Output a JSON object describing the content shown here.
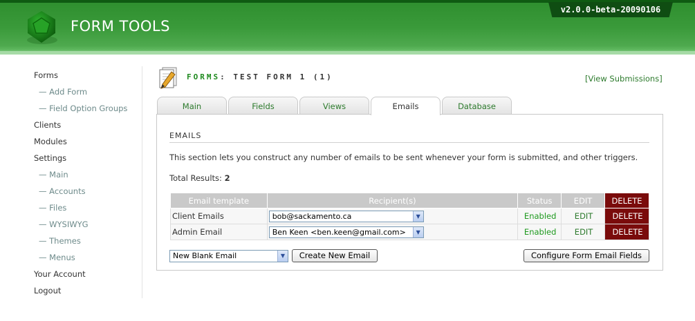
{
  "app": {
    "title": "FORM TOOLS",
    "version": "v2.0.0-beta-20090106"
  },
  "colors": {
    "brand_green": "#3a9a3a",
    "dark_green": "#0f4d12",
    "delete_red": "#7a0b0b",
    "link_green": "#2c7a2c"
  },
  "sidebar": {
    "items": [
      {
        "label": "Forms",
        "level": 0
      },
      {
        "label": "— Add Form",
        "level": 1
      },
      {
        "label": "— Field Option Groups",
        "level": 1
      },
      {
        "label": "Clients",
        "level": 0
      },
      {
        "label": "Modules",
        "level": 0
      },
      {
        "label": "Settings",
        "level": 0
      },
      {
        "label": "— Main",
        "level": 1
      },
      {
        "label": "— Accounts",
        "level": 1
      },
      {
        "label": "— Files",
        "level": 1
      },
      {
        "label": "— WYSIWYG",
        "level": 1
      },
      {
        "label": "— Themes",
        "level": 1
      },
      {
        "label": "— Menus",
        "level": 1
      },
      {
        "label": "Your Account",
        "level": 0
      },
      {
        "label": "Logout",
        "level": 0
      }
    ]
  },
  "page": {
    "icon": "edit-form-icon",
    "title_prefix": "FORMS",
    "title_suffix": ": TEST FORM 1 (1)",
    "view_submissions": "[View Submissions]"
  },
  "tabs": [
    {
      "label": "Main",
      "active": false
    },
    {
      "label": "Fields",
      "active": false
    },
    {
      "label": "Views",
      "active": false
    },
    {
      "label": "Emails",
      "active": true
    },
    {
      "label": "Database",
      "active": false
    }
  ],
  "emails": {
    "section_title": "EMAILS",
    "description": "This section lets you construct any number of emails to be sent whenever your form is submitted, and other triggers.",
    "total_label": "Total Results:",
    "total_value": "2",
    "columns": [
      "Email template",
      "Recipient(s)",
      "Status",
      "EDIT",
      "DELETE"
    ],
    "rows": [
      {
        "template": "Client Emails",
        "recipient": "bob@sackamento.ca",
        "status": "Enabled",
        "edit": "EDIT",
        "delete": "DELETE"
      },
      {
        "template": "Admin Email",
        "recipient": "Ben Keen <ben.keen@gmail.com>",
        "status": "Enabled",
        "edit": "EDIT",
        "delete": "DELETE"
      }
    ],
    "new_email_select": "New Blank Email",
    "create_button": "Create New Email",
    "configure_button": "Configure Form Email Fields"
  }
}
